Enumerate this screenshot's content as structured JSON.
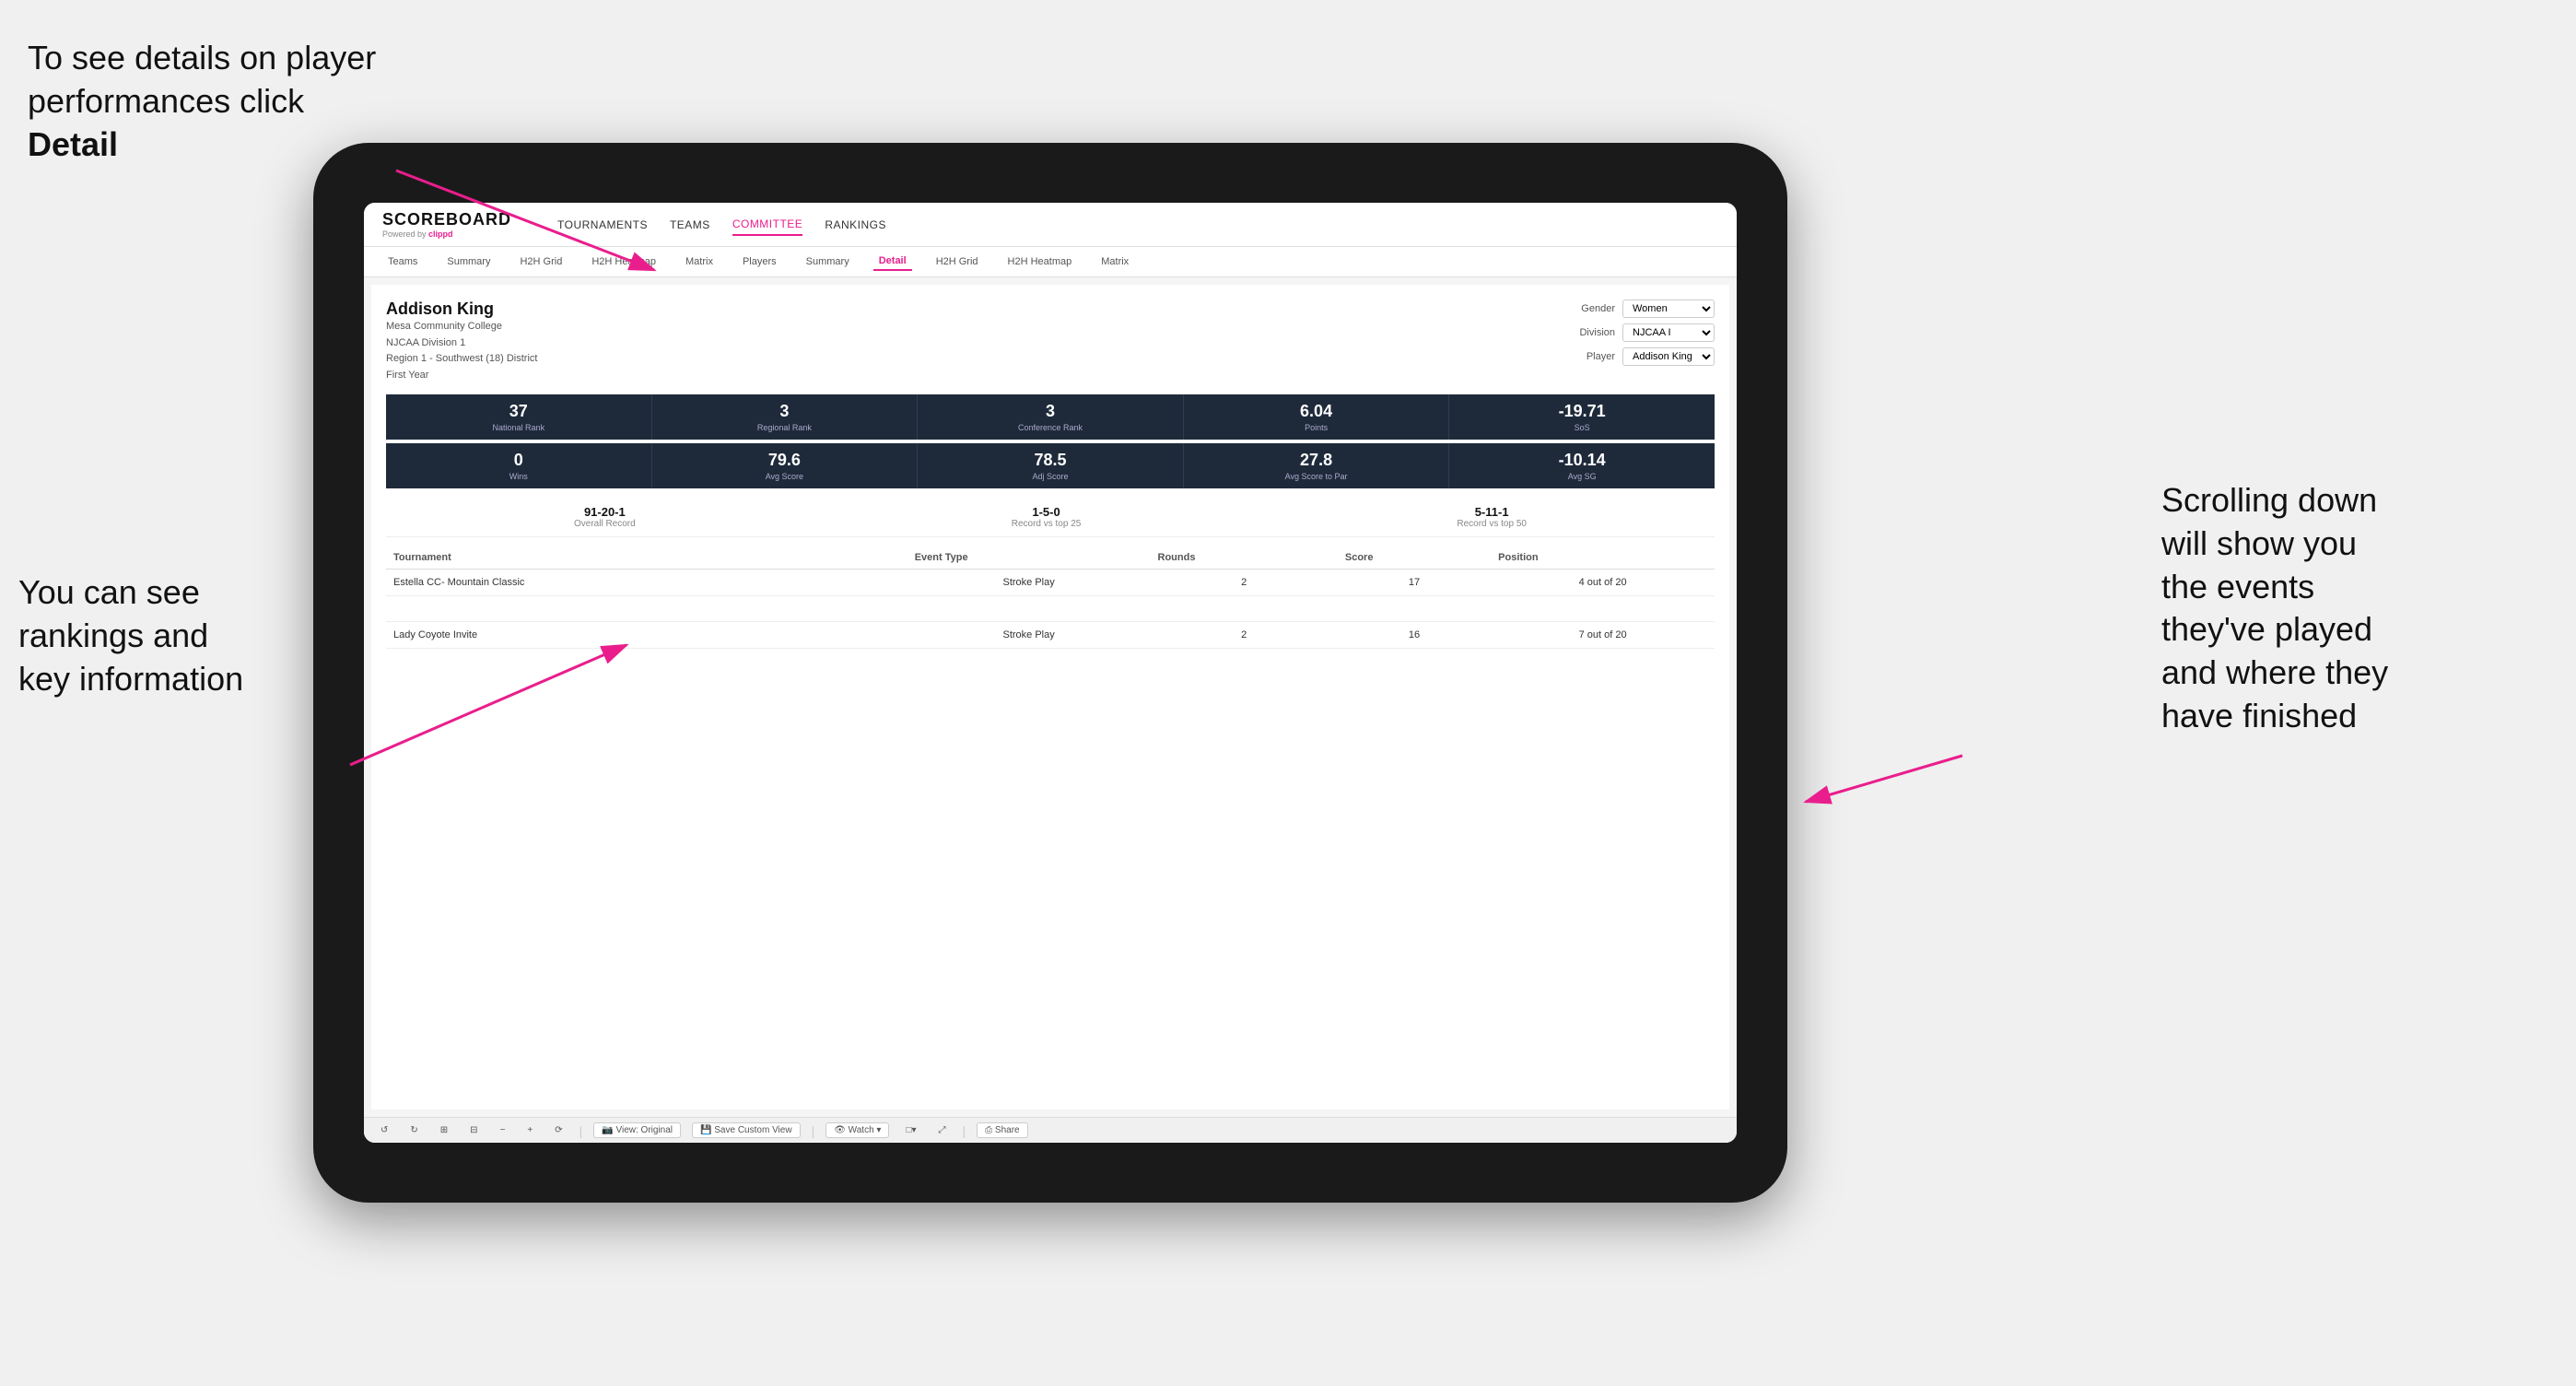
{
  "annotations": {
    "top_left": "To see details on player performances click Detail",
    "top_left_bold": "Detail",
    "bottom_left_line1": "You can see",
    "bottom_left_line2": "rankings and",
    "bottom_left_line3": "key information",
    "right_line1": "Scrolling down",
    "right_line2": "will show you",
    "right_line3": "the events",
    "right_line4": "they've played",
    "right_line5": "and where they",
    "right_line6": "have finished"
  },
  "nav": {
    "logo": "SCOREBOARD",
    "logo_sub": "Powered by",
    "logo_brand": "clippd",
    "items": [
      "TOURNAMENTS",
      "TEAMS",
      "COMMITTEE",
      "RANKINGS"
    ],
    "active": "COMMITTEE"
  },
  "sub_nav": {
    "items": [
      "Teams",
      "Summary",
      "H2H Grid",
      "H2H Heatmap",
      "Matrix",
      "Players",
      "Summary",
      "Detail",
      "H2H Grid",
      "H2H Heatmap",
      "Matrix"
    ],
    "active": "Detail"
  },
  "player": {
    "name": "Addison King",
    "college": "Mesa Community College",
    "division": "NJCAA Division 1",
    "region": "Region 1 - Southwest (18) District",
    "year": "First Year",
    "gender_label": "Gender",
    "gender_value": "Women",
    "division_label": "Division",
    "division_value": "NJCAA I",
    "player_label": "Player",
    "player_value": "Addison King"
  },
  "stats_row1": [
    {
      "value": "37",
      "label": "National Rank"
    },
    {
      "value": "3",
      "label": "Regional Rank"
    },
    {
      "value": "3",
      "label": "Conference Rank"
    },
    {
      "value": "6.04",
      "label": "Points"
    },
    {
      "value": "-19.71",
      "label": "SoS"
    }
  ],
  "stats_row2": [
    {
      "value": "0",
      "label": "Wins"
    },
    {
      "value": "79.6",
      "label": "Avg Score"
    },
    {
      "value": "78.5",
      "label": "Adj Score"
    },
    {
      "value": "27.8",
      "label": "Avg Score to Par"
    },
    {
      "value": "-10.14",
      "label": "Avg SG"
    }
  ],
  "records": [
    {
      "value": "91-20-1",
      "label": "Overall Record"
    },
    {
      "value": "1-5-0",
      "label": "Record vs top 25"
    },
    {
      "value": "5-11-1",
      "label": "Record vs top 50"
    }
  ],
  "table": {
    "headers": [
      "Tournament",
      "Event Type",
      "Rounds",
      "Score",
      "Position"
    ],
    "rows": [
      {
        "tournament": "Estella CC- Mountain Classic",
        "event_type": "Stroke Play",
        "rounds": "2",
        "score": "17",
        "position": "4 out of 20"
      },
      {
        "tournament": "",
        "event_type": "",
        "rounds": "",
        "score": "",
        "position": ""
      },
      {
        "tournament": "Lady Coyote Invite",
        "event_type": "Stroke Play",
        "rounds": "2",
        "score": "16",
        "position": "7 out of 20"
      }
    ]
  },
  "toolbar": {
    "items": [
      "↺",
      "↻",
      "⊞",
      "⊟",
      "−",
      "+",
      "⟳",
      "View: Original",
      "Save Custom View",
      "Watch ▾",
      "□▾",
      "⤢",
      "Share"
    ]
  }
}
